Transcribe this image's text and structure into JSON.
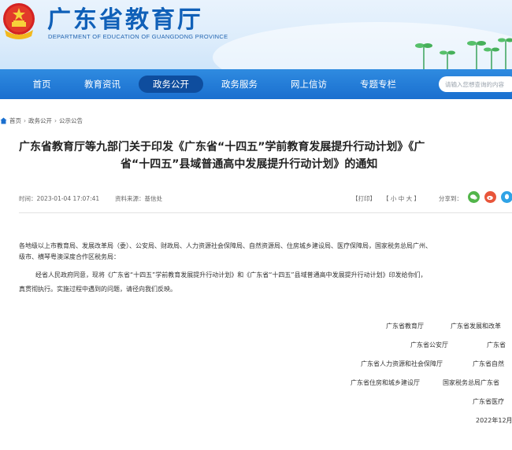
{
  "header": {
    "site_title": "广东省教育厅",
    "site_subtitle": "DEPARTMENT OF EDUCATION OF GUANGDONG PROVINCE",
    "emblem_icon": "national-emblem-icon",
    "decoration_icon": "sprout-icon"
  },
  "nav": {
    "items": [
      {
        "label": "首页"
      },
      {
        "label": "教育资讯"
      },
      {
        "label": "政务公开",
        "active": true
      },
      {
        "label": "政务服务"
      },
      {
        "label": "网上信访"
      },
      {
        "label": "专题专栏"
      }
    ],
    "search_placeholder": "请输入您想查询的内容"
  },
  "breadcrumb": {
    "items": [
      "首页",
      "政务公开",
      "公示公告"
    ],
    "separator": "›"
  },
  "article": {
    "title_line1": "广东省教育厅等九部门关于印发《广东省“十四五”学前教育发展提升行动计划》《广",
    "title_line2": "省“十四五”县域普通高中发展提升行动计划》的通知",
    "time": "时间：2023-01-04 17:07:41",
    "source": "资料来源：基信处",
    "print": "【打印】",
    "font_size_label": "【 小  中  大 】",
    "share_label": "分享到：",
    "share_icons": [
      "wechat-icon",
      "weibo-icon",
      "qq-icon"
    ],
    "addressee_line1": "各地级以上市教育局、发展改革局（委）、公安局、财政局、人力资源社会保障局、自然资源局、住房城乡建设局、医疗保障局，国家税务总局广州、",
    "addressee_line2": "级市、横琴粤澳深度合作区税务局：",
    "body_line1": "经省人民政府同意，现将《广东省“十四五”学前教育发展提升行动计划》和《广东省“十四五”县域普通高中发展提升行动计划》印发给你们，",
    "body_line2": "真贯彻执行。实施过程中遇到的问题，请径向我们反映。",
    "signatures": [
      [
        "广东省教育厅",
        "广东省发展和改革"
      ],
      [
        "广东省公安厅",
        "广东省"
      ],
      [
        "广东省人力资源和社会保障厅",
        "广东省自然"
      ],
      [
        "广东省住房和城乡建设厅",
        "国家税务总局广东省"
      ],
      [
        "广东省医疗"
      ]
    ],
    "date": "2022年12月"
  },
  "colors": {
    "nav_bg": "#1a6fcf",
    "nav_active": "#0e4d9e",
    "title_blue": "#1060b8"
  }
}
